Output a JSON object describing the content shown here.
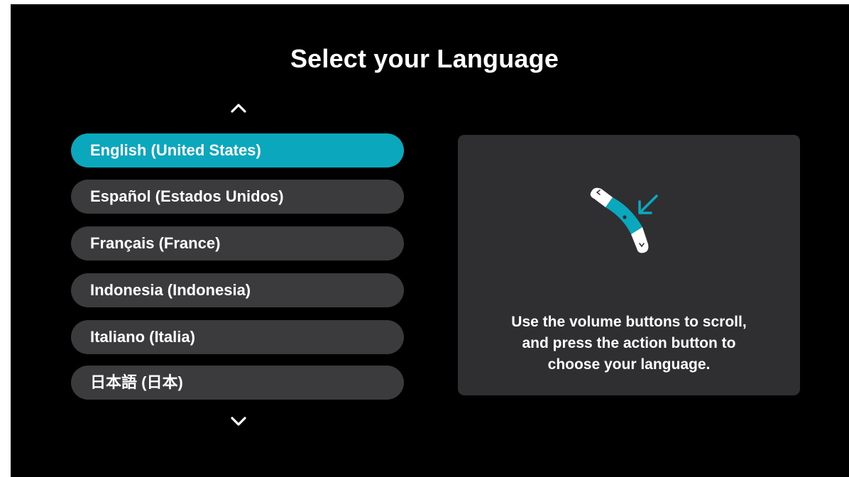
{
  "screen": {
    "title": "Select your Language"
  },
  "language_list": {
    "scroll_up_icon": "chevron-up",
    "scroll_down_icon": "chevron-down",
    "selected_index": 0,
    "items": [
      {
        "label": "English (United States)"
      },
      {
        "label": "Español (Estados Unidos)"
      },
      {
        "label": "Français (France)"
      },
      {
        "label": "Indonesia (Indonesia)"
      },
      {
        "label": "Italiano (Italia)"
      },
      {
        "label": "日本語 (日本)"
      }
    ]
  },
  "info_panel": {
    "illustration_icon": "volume-buttons-illustration",
    "lines": [
      "Use the volume buttons to scroll,",
      "and press the action button to",
      "choose your language."
    ]
  },
  "colors": {
    "background": "#000000",
    "accent": "#0aa7bd",
    "item_background": "#3b3b3d",
    "panel_background": "#2f2f31",
    "text": "#ffffff"
  }
}
